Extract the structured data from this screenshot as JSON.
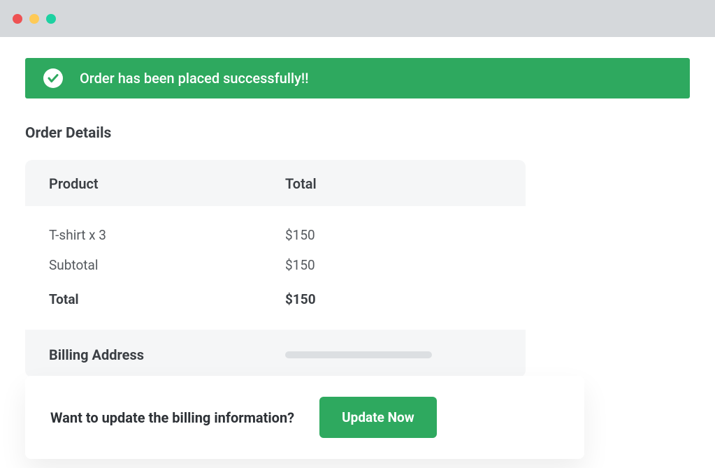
{
  "alert": {
    "message": "Order has been placed successfully!!"
  },
  "order": {
    "section_title": "Order Details",
    "headers": {
      "product": "Product",
      "total": "Total"
    },
    "rows": [
      {
        "label": "T-shirt x 3",
        "value": "$150"
      },
      {
        "label": "Subtotal",
        "value": "$150"
      }
    ],
    "total_row": {
      "label": "Total",
      "value": "$150"
    },
    "billing_label": "Billing Address"
  },
  "update_prompt": {
    "text": "Want to update the billing information?",
    "button": "Update Now"
  }
}
